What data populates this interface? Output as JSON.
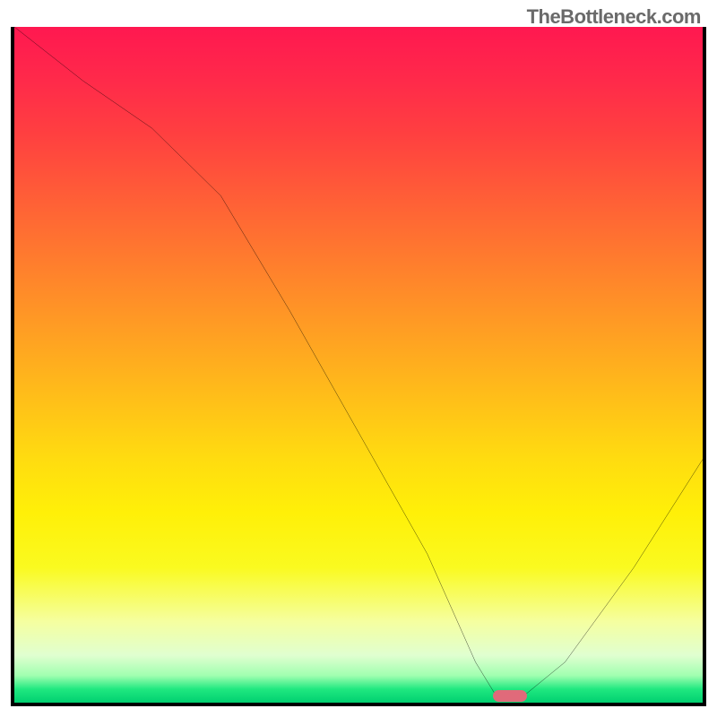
{
  "watermark": "TheBottleneck.com",
  "chart_data": {
    "type": "line",
    "title": "",
    "xlabel": "",
    "ylabel": "",
    "xlim": [
      0,
      100
    ],
    "ylim": [
      0,
      100
    ],
    "x": [
      0,
      10,
      20,
      30,
      40,
      50,
      60,
      67,
      70,
      74,
      80,
      90,
      100
    ],
    "values": [
      100,
      92,
      85,
      75,
      58,
      40,
      22,
      6,
      1,
      1,
      6,
      20,
      36
    ],
    "marker": {
      "x": 72,
      "y": 1,
      "width": 5,
      "height": 1.6,
      "color": "#e06a7a"
    },
    "gradient_stops": [
      {
        "pos": 0,
        "color": "#ff1850"
      },
      {
        "pos": 50,
        "color": "#ffb81c"
      },
      {
        "pos": 80,
        "color": "#fafa20"
      },
      {
        "pos": 100,
        "color": "#00d070"
      }
    ]
  }
}
